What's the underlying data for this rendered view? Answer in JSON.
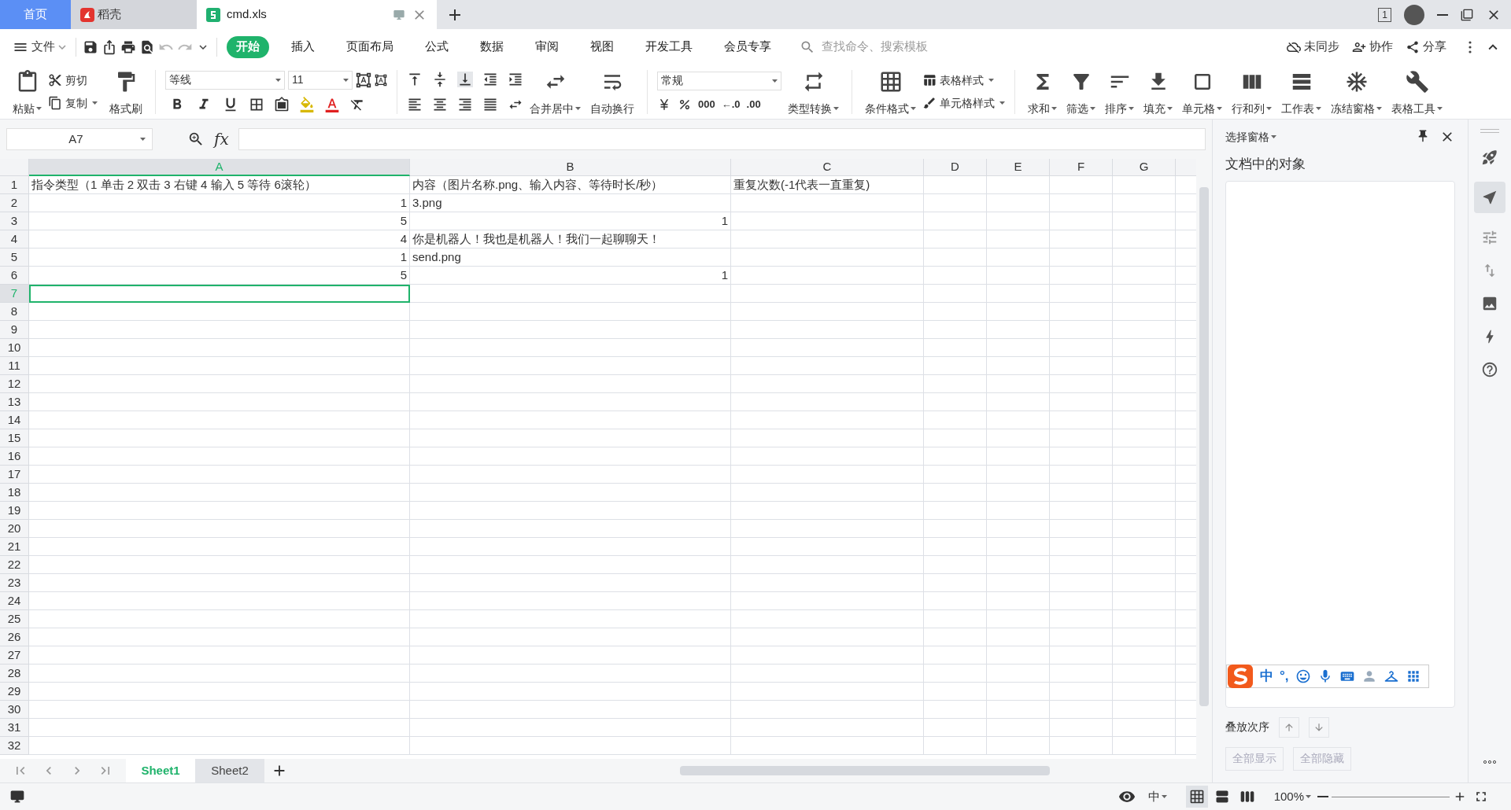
{
  "title_tabs": [
    {
      "label": "首页",
      "kind": "home",
      "selected": false
    },
    {
      "label": "稻壳",
      "kind": "docer",
      "selected": false
    },
    {
      "label": "cmd.xls",
      "kind": "sheet",
      "selected": true
    }
  ],
  "window_badge": "1",
  "menu": {
    "file": "文件",
    "tabs": [
      {
        "label": "开始",
        "selected": true
      },
      {
        "label": "插入",
        "selected": false
      },
      {
        "label": "页面布局",
        "selected": false
      },
      {
        "label": "公式",
        "selected": false
      },
      {
        "label": "数据",
        "selected": false
      },
      {
        "label": "审阅",
        "selected": false
      },
      {
        "label": "视图",
        "selected": false
      },
      {
        "label": "开发工具",
        "selected": false
      },
      {
        "label": "会员专享",
        "selected": false
      }
    ],
    "search": {
      "placeholder": "查找命令、搜索模板"
    },
    "actions": [
      "未同步",
      "协作",
      "分享"
    ]
  },
  "ribbon": {
    "paste": "粘贴",
    "cut": "剪切",
    "copy": "复制",
    "format_painter": "格式刷",
    "font_name": "等线",
    "font_size": "11",
    "merge": "合并居中",
    "wrap": "自动换行",
    "number_format": "常规",
    "number_buttons": [
      "000",
      "←.0",
      ".00"
    ],
    "convert": "类型转换",
    "conditional": "条件格式",
    "table_style": "表格样式",
    "cell_style": "单元格样式",
    "tools": [
      "求和",
      "筛选",
      "排序",
      "填充",
      "单元格",
      "行和列",
      "工作表",
      "冻结窗格",
      "表格工具"
    ]
  },
  "formula_bar": {
    "name_box": "A7",
    "fx": "fx"
  },
  "columns": [
    {
      "label": "A",
      "selected": true
    },
    {
      "label": "B",
      "selected": false
    },
    {
      "label": "C",
      "selected": false
    },
    {
      "label": "D",
      "selected": false
    },
    {
      "label": "E",
      "selected": false
    },
    {
      "label": "F",
      "selected": false
    },
    {
      "label": "G",
      "selected": false
    }
  ],
  "rows": [
    {
      "header": "1",
      "selected": false,
      "cells": [
        {
          "text": "指令类型（1 单击  2 双击  3 右键  4 输入  5 等待  6滚轮）",
          "kind": "text"
        },
        {
          "text": "内容（图片名称.png、输入内容、等待时长/秒）",
          "kind": "text"
        },
        {
          "text": "重复次数(-1代表一直重复)",
          "kind": "text"
        }
      ]
    },
    {
      "header": "2",
      "selected": false,
      "cells": [
        {
          "text": "1",
          "kind": "number"
        },
        {
          "text": "3.png",
          "kind": "text"
        }
      ]
    },
    {
      "header": "3",
      "selected": false,
      "cells": [
        {
          "text": "5",
          "kind": "number"
        },
        {
          "text": "1",
          "kind": "number"
        }
      ]
    },
    {
      "header": "4",
      "selected": false,
      "cells": [
        {
          "text": "4",
          "kind": "number"
        },
        {
          "text": "你是机器人！我也是机器人！我们一起聊聊天！",
          "kind": "text"
        }
      ]
    },
    {
      "header": "5",
      "selected": false,
      "cells": [
        {
          "text": "1",
          "kind": "number"
        },
        {
          "text": "send.png",
          "kind": "text"
        }
      ]
    },
    {
      "header": "6",
      "selected": false,
      "cells": [
        {
          "text": "5",
          "kind": "number"
        },
        {
          "text": "1",
          "kind": "number"
        }
      ]
    },
    {
      "header": "7",
      "selected": true,
      "cells": [
        {
          "kind": "text",
          "selected": true
        }
      ]
    },
    {
      "header": "8",
      "selected": false
    },
    {
      "header": "9",
      "selected": false
    },
    {
      "header": "10",
      "selected": false
    },
    {
      "header": "11",
      "selected": false
    },
    {
      "header": "12",
      "selected": false
    },
    {
      "header": "13",
      "selected": false
    },
    {
      "header": "14",
      "selected": false
    },
    {
      "header": "15",
      "selected": false
    },
    {
      "header": "16",
      "selected": false
    },
    {
      "header": "17",
      "selected": false
    },
    {
      "header": "18",
      "selected": false
    },
    {
      "header": "19",
      "selected": false
    },
    {
      "header": "20",
      "selected": false
    },
    {
      "header": "21",
      "selected": false
    },
    {
      "header": "22",
      "selected": false
    },
    {
      "header": "23",
      "selected": false
    },
    {
      "header": "24",
      "selected": false
    },
    {
      "header": "25",
      "selected": false
    },
    {
      "header": "26",
      "selected": false
    },
    {
      "header": "27",
      "selected": false
    },
    {
      "header": "28",
      "selected": false
    },
    {
      "header": "29",
      "selected": false
    },
    {
      "header": "30",
      "selected": false
    },
    {
      "header": "31",
      "selected": false
    },
    {
      "header": "32",
      "selected": false
    }
  ],
  "sheet_tabs": [
    {
      "label": "Sheet1",
      "selected": true
    },
    {
      "label": "Sheet2",
      "selected": false
    }
  ],
  "selection_pane": {
    "title": "选择窗格",
    "heading": "文档中的对象",
    "ime": {
      "mode": "中",
      "punctuation": "°,"
    },
    "order_label": "叠放次序",
    "buttons": [
      {
        "label": "全部显示",
        "disabled": true
      },
      {
        "label": "全部隐藏",
        "disabled": true
      }
    ]
  },
  "status_bar": {
    "input_mode": "中",
    "zoom": "100%"
  }
}
